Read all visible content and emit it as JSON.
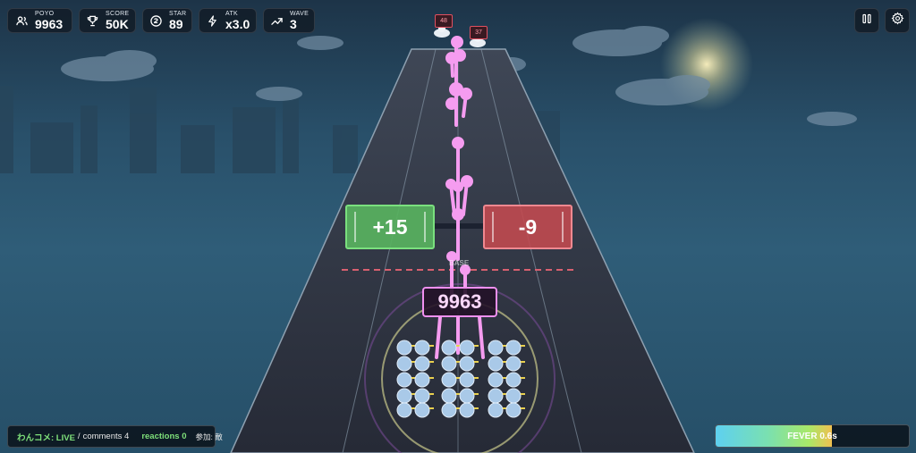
{
  "hud": {
    "poyo": {
      "label": "POYO",
      "value": "9963",
      "icon": "users-icon"
    },
    "score": {
      "label": "SCORE",
      "value": "50K",
      "icon": "trophy-icon"
    },
    "star": {
      "label": "STAR",
      "value": "89",
      "icon": "star-coin-icon"
    },
    "atk": {
      "label": "ATK",
      "value": "x3.0",
      "icon": "bolt-icon"
    },
    "wave": {
      "label": "WAVE",
      "value": "3",
      "icon": "trend-up-icon"
    }
  },
  "controls": {
    "pause_icon": "pause-icon",
    "settings_icon": "gear-icon"
  },
  "gates": {
    "left": "+15",
    "right": "-9"
  },
  "base_label": "BASE",
  "army_count": "9963",
  "enemies": [
    {
      "hp": "48"
    },
    {
      "hp": "37"
    }
  ],
  "live_bar": {
    "app": "わんコメ: LIVE",
    "separator": "/",
    "comments": "comments 4",
    "reactions": "reactions 0",
    "join": "参加: 敵"
  },
  "fever": {
    "label": "FEVER 0.6s",
    "progress": 0.6
  },
  "colors": {
    "gate_plus": "#58b25f",
    "gate_minus": "#c44a50",
    "unit_trail": "#f59cf0",
    "accent_live": "#7ee07a"
  }
}
